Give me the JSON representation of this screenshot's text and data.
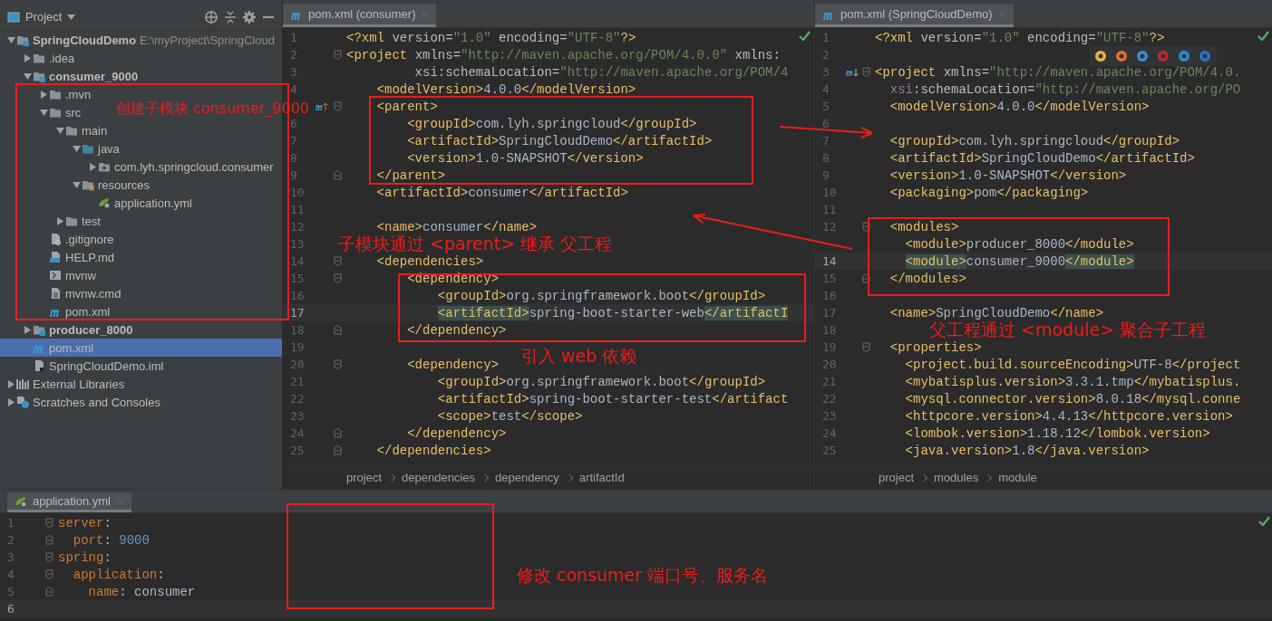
{
  "project_panel": {
    "title": "Project",
    "tree": [
      {
        "label": "SpringCloudDemo",
        "kind": "module",
        "hint": "E:\\myProject\\SpringCloud",
        "expanded": true,
        "selected": false,
        "children": [
          {
            "label": ".idea",
            "kind": "folder",
            "expanded": false,
            "selected": false
          },
          {
            "label": "consumer_9000",
            "kind": "module",
            "expanded": true,
            "selected": false,
            "children": [
              {
                "label": ".mvn",
                "kind": "folder",
                "expanded": false,
                "selected": false
              },
              {
                "label": "src",
                "kind": "folder",
                "expanded": true,
                "selected": false,
                "children": [
                  {
                    "label": "main",
                    "kind": "folder",
                    "expanded": true,
                    "selected": false,
                    "children": [
                      {
                        "label": "java",
                        "kind": "source",
                        "expanded": true,
                        "selected": false,
                        "children": [
                          {
                            "label": "com.lyh.springcloud.consumer",
                            "kind": "package",
                            "expanded": false,
                            "selected": false
                          }
                        ]
                      },
                      {
                        "label": "resources",
                        "kind": "resources",
                        "expanded": true,
                        "selected": false,
                        "children": [
                          {
                            "label": "application.yml",
                            "kind": "yml",
                            "selected": false
                          }
                        ]
                      }
                    ]
                  },
                  {
                    "label": "test",
                    "kind": "folder",
                    "expanded": false,
                    "selected": false
                  }
                ]
              },
              {
                "label": ".gitignore",
                "kind": "ignore",
                "selected": false
              },
              {
                "label": "HELP.md",
                "kind": "md",
                "selected": false
              },
              {
                "label": "mvnw",
                "kind": "script",
                "selected": false
              },
              {
                "label": "mvnw.cmd",
                "kind": "file",
                "selected": false
              },
              {
                "label": "pom.xml",
                "kind": "maven",
                "selected": false
              }
            ]
          },
          {
            "label": "producer_8000",
            "kind": "module",
            "expanded": false,
            "selected": false
          },
          {
            "label": "pom.xml",
            "kind": "maven",
            "selected": true
          },
          {
            "label": "SpringCloudDemo.iml",
            "kind": "iml",
            "selected": false
          }
        ]
      },
      {
        "label": "External Libraries",
        "kind": "libraries",
        "expanded": false,
        "selected": false
      },
      {
        "label": "Scratches and Consoles",
        "kind": "scratches",
        "expanded": false,
        "selected": false
      }
    ]
  },
  "editors": [
    {
      "tab": "pom.xml (consumer)",
      "breadcrumbs": [
        "project",
        "dependencies",
        "dependency",
        "artifactId"
      ],
      "lines": [
        {
          "n": "1",
          "kind": "plain",
          "current": false,
          "segs": [
            {
              "kind": "tag",
              "text": "<?xml "
            },
            {
              "kind": "attr",
              "text": "version="
            },
            {
              "kind": "value",
              "text": "\"1.0\""
            },
            {
              "kind": "attr",
              "text": " encoding="
            },
            {
              "kind": "value",
              "text": "\"UTF-8\""
            },
            {
              "kind": "tag",
              "text": "?>"
            }
          ]
        },
        {
          "n": "2",
          "kind": "fold-start",
          "current": false,
          "segs": [
            {
              "kind": "tag",
              "text": "<project "
            },
            {
              "kind": "attr",
              "text": "xmlns="
            },
            {
              "kind": "value",
              "text": "\"http://maven.apache.org/POM/4.0.0\""
            },
            {
              "kind": "attr",
              "text": " xmlns:"
            }
          ]
        },
        {
          "n": "3",
          "kind": "plain",
          "current": false,
          "segs": [
            {
              "kind": "attr",
              "text": "         xsi:schemaLocation="
            },
            {
              "kind": "value",
              "text": "\"http://maven.apache.org/POM/4"
            }
          ]
        },
        {
          "n": "4",
          "kind": "plain",
          "current": false,
          "segs": [
            {
              "kind": "tag",
              "text": "    <modelVersion>"
            },
            {
              "kind": "text",
              "text": "4.0.0"
            },
            {
              "kind": "tag",
              "text": "</modelVersion>"
            }
          ]
        },
        {
          "kind": "override-fold-start",
          "segs": [
            {
              "kind": "tag",
              "text": "    <parent>"
            }
          ]
        },
        {
          "n": "6",
          "kind": "plain",
          "current": false,
          "segs": [
            {
              "kind": "tag",
              "text": "        <groupId>"
            },
            {
              "kind": "text",
              "text": "com.lyh.springcloud"
            },
            {
              "kind": "tag",
              "text": "</groupId>"
            }
          ]
        },
        {
          "n": "7",
          "kind": "plain",
          "current": false,
          "segs": [
            {
              "kind": "tag",
              "text": "        <artifactId>"
            },
            {
              "kind": "text",
              "text": "SpringCloudDemo"
            },
            {
              "kind": "tag",
              "text": "</artifactId>"
            }
          ]
        },
        {
          "n": "8",
          "kind": "plain",
          "current": false,
          "segs": [
            {
              "kind": "tag",
              "text": "        <version>"
            },
            {
              "kind": "text",
              "text": "1.0-SNAPSHOT"
            },
            {
              "kind": "tag",
              "text": "</version>"
            }
          ]
        },
        {
          "n": "9",
          "kind": "fold-end",
          "current": false,
          "segs": [
            {
              "kind": "tag",
              "text": "    </parent>"
            }
          ]
        },
        {
          "n": "10",
          "kind": "plain",
          "current": false,
          "segs": [
            {
              "kind": "tag",
              "text": "    <artifactId>"
            },
            {
              "kind": "text",
              "text": "consumer"
            },
            {
              "kind": "tag",
              "text": "</artifactId>"
            }
          ]
        },
        {
          "n": "11",
          "kind": "plain",
          "current": false
        },
        {
          "n": "12",
          "kind": "plain",
          "current": false,
          "segs": [
            {
              "kind": "tag",
              "text": "    <name>"
            },
            {
              "kind": "text",
              "text": "consumer"
            },
            {
              "kind": "tag",
              "text": "</name>"
            }
          ]
        },
        {
          "n": "13",
          "kind": "plain",
          "current": false
        },
        {
          "n": "14",
          "kind": "fold-start",
          "current": false,
          "segs": [
            {
              "kind": "tag",
              "text": "    <dependencies>"
            }
          ]
        },
        {
          "n": "15",
          "kind": "fold-start",
          "current": false,
          "segs": [
            {
              "kind": "tag",
              "text": "        <dependency>"
            }
          ]
        },
        {
          "n": "16",
          "kind": "plain",
          "current": false,
          "segs": [
            {
              "kind": "tag",
              "text": "            <groupId>"
            },
            {
              "kind": "text",
              "text": "org.springframework.boot"
            },
            {
              "kind": "tag",
              "text": "</groupId>"
            }
          ]
        },
        {
          "n": "17",
          "kind": "plain",
          "current": true,
          "segs": [
            {
              "kind": "tag-match",
              "text": "            <artifactId>"
            },
            {
              "kind": "text",
              "text": "spring-boot-starter-web"
            },
            {
              "kind": "tag-match",
              "text": "</artifactI"
            }
          ]
        },
        {
          "n": "18",
          "kind": "fold-end",
          "current": false,
          "segs": [
            {
              "kind": "tag",
              "text": "        </dependency>"
            }
          ]
        },
        {
          "n": "19",
          "kind": "plain",
          "current": false
        },
        {
          "n": "20",
          "kind": "fold-start",
          "current": false,
          "segs": [
            {
              "kind": "tag",
              "text": "        <dependency>"
            }
          ]
        },
        {
          "n": "21",
          "kind": "plain",
          "current": false,
          "segs": [
            {
              "kind": "tag",
              "text": "            <groupId>"
            },
            {
              "kind": "text",
              "text": "org.springframework.boot"
            },
            {
              "kind": "tag",
              "text": "</groupId>"
            }
          ]
        },
        {
          "n": "22",
          "kind": "plain",
          "current": false,
          "segs": [
            {
              "kind": "tag",
              "text": "            <artifactId>"
            },
            {
              "kind": "text",
              "text": "spring-boot-starter-test"
            },
            {
              "kind": "tag",
              "text": "</artifact"
            }
          ]
        },
        {
          "n": "23",
          "kind": "plain",
          "current": false,
          "segs": [
            {
              "kind": "tag",
              "text": "            <scope>"
            },
            {
              "kind": "text",
              "text": "test"
            },
            {
              "kind": "tag",
              "text": "</scope>"
            }
          ]
        },
        {
          "n": "24",
          "kind": "fold-end",
          "current": false,
          "segs": [
            {
              "kind": "tag",
              "text": "        </dependency>"
            }
          ]
        },
        {
          "n": "25",
          "kind": "fold-end",
          "current": false,
          "segs": [
            {
              "kind": "tag",
              "text": "    </dependencies>"
            }
          ]
        }
      ]
    },
    {
      "tab": "pom.xml (SpringCloudDemo)",
      "breadcrumbs": [
        "project",
        "modules",
        "module"
      ],
      "lines": [
        {
          "n": "1",
          "kind": "plain",
          "current": false,
          "segs": [
            {
              "kind": "tag",
              "text": "<?xml "
            },
            {
              "kind": "attr",
              "text": "version="
            },
            {
              "kind": "value",
              "text": "\"1.0\""
            },
            {
              "kind": "attr",
              "text": " encoding="
            },
            {
              "kind": "value",
              "text": "\"UTF-8\""
            },
            {
              "kind": "tag",
              "text": "?>"
            }
          ]
        },
        {
          "n": "2",
          "kind": "browser-bar",
          "current": false
        },
        {
          "n": "3",
          "kind": "overridden-fold-start",
          "current": false,
          "segs": [
            {
              "kind": "tag",
              "text": "<project "
            },
            {
              "kind": "attr",
              "text": "xmlns="
            },
            {
              "kind": "value",
              "text": "\"http://maven.apache.org/POM/4.0."
            }
          ]
        },
        {
          "n": "4",
          "kind": "plain",
          "current": false,
          "segs": [
            {
              "kind": "ns",
              "text": "  xsi"
            },
            {
              "kind": "attr",
              "text": ":schemaLocation="
            },
            {
              "kind": "value",
              "text": "\"http://maven.apache.org/PO"
            }
          ]
        },
        {
          "n": "5",
          "kind": "plain",
          "current": false,
          "segs": [
            {
              "kind": "tag",
              "text": "  <modelVersion>"
            },
            {
              "kind": "text",
              "text": "4.0.0"
            },
            {
              "kind": "tag",
              "text": "</modelVersion>"
            }
          ]
        },
        {
          "n": "6",
          "kind": "plain",
          "current": false
        },
        {
          "n": "7",
          "kind": "plain",
          "current": false,
          "segs": [
            {
              "kind": "tag",
              "text": "  <groupId>"
            },
            {
              "kind": "text",
              "text": "com.lyh.springcloud"
            },
            {
              "kind": "tag",
              "text": "</groupId>"
            }
          ]
        },
        {
          "n": "8",
          "kind": "plain",
          "current": false,
          "segs": [
            {
              "kind": "tag",
              "text": "  <artifactId>"
            },
            {
              "kind": "text",
              "text": "SpringCloudDemo"
            },
            {
              "kind": "tag",
              "text": "</artifactId>"
            }
          ]
        },
        {
          "n": "9",
          "kind": "plain",
          "current": false,
          "segs": [
            {
              "kind": "tag",
              "text": "  <version>"
            },
            {
              "kind": "text",
              "text": "1.0-SNAPSHOT"
            },
            {
              "kind": "tag",
              "text": "</version>"
            }
          ]
        },
        {
          "n": "10",
          "kind": "plain",
          "current": false,
          "segs": [
            {
              "kind": "tag",
              "text": "  <packaging>"
            },
            {
              "kind": "text",
              "text": "pom"
            },
            {
              "kind": "tag",
              "text": "</packaging>"
            }
          ]
        },
        {
          "n": "11",
          "kind": "plain",
          "current": false
        },
        {
          "n": "12",
          "kind": "fold-start",
          "current": false,
          "segs": [
            {
              "kind": "tag",
              "text": "  <modules>"
            }
          ]
        },
        {
          "kind": "plain",
          "segs": [
            {
              "kind": "tag",
              "text": "    <module>"
            },
            {
              "kind": "text",
              "text": "producer_8000"
            },
            {
              "kind": "tag",
              "text": "</module>"
            }
          ]
        },
        {
          "n": "14",
          "kind": "plain",
          "current": true,
          "segs": [
            {
              "kind": "tag-match",
              "text": "    <module>"
            },
            {
              "kind": "text",
              "text": "consumer_9000"
            },
            {
              "kind": "tag-match",
              "text": "</module>"
            }
          ]
        },
        {
          "n": "15",
          "kind": "fold-end",
          "current": false,
          "segs": [
            {
              "kind": "tag",
              "text": "  </modules>"
            }
          ]
        },
        {
          "n": "16",
          "kind": "plain",
          "current": false
        },
        {
          "n": "17",
          "kind": "plain",
          "current": false,
          "segs": [
            {
              "kind": "tag",
              "text": "  <name>"
            },
            {
              "kind": "text",
              "text": "SpringCloudDemo"
            },
            {
              "kind": "tag",
              "text": "</name>"
            }
          ]
        },
        {
          "n": "18",
          "kind": "plain",
          "current": false
        },
        {
          "n": "19",
          "kind": "fold-start",
          "current": false,
          "segs": [
            {
              "kind": "tag",
              "text": "  <properties>"
            }
          ]
        },
        {
          "n": "20",
          "kind": "plain",
          "current": false,
          "segs": [
            {
              "kind": "tag",
              "text": "    <project.build.sourceEncoding>"
            },
            {
              "kind": "text",
              "text": "UTF-8"
            },
            {
              "kind": "tag",
              "text": "</project"
            }
          ]
        },
        {
          "n": "21",
          "kind": "plain",
          "current": false,
          "segs": [
            {
              "kind": "tag",
              "text": "    <mybatisplus.version>"
            },
            {
              "kind": "text",
              "text": "3.3.1.tmp"
            },
            {
              "kind": "tag",
              "text": "</mybatisplus."
            }
          ]
        },
        {
          "n": "22",
          "kind": "plain",
          "current": false,
          "segs": [
            {
              "kind": "tag",
              "text": "    <mysql.connector.version>"
            },
            {
              "kind": "text",
              "text": "8.0.18"
            },
            {
              "kind": "tag",
              "text": "</mysql.conne"
            }
          ]
        },
        {
          "n": "23",
          "kind": "plain",
          "current": false,
          "segs": [
            {
              "kind": "tag",
              "text": "    <httpcore.version>"
            },
            {
              "kind": "text",
              "text": "4.4.13"
            },
            {
              "kind": "tag",
              "text": "</httpcore.version>"
            }
          ]
        },
        {
          "n": "24",
          "kind": "plain",
          "current": false,
          "segs": [
            {
              "kind": "tag",
              "text": "    <lombok.version>"
            },
            {
              "kind": "text",
              "text": "1.18.12"
            },
            {
              "kind": "tag",
              "text": "</lombok.version>"
            }
          ]
        },
        {
          "n": "25",
          "kind": "plain",
          "current": false,
          "segs": [
            {
              "kind": "tag",
              "text": "    <java.version>"
            },
            {
              "kind": "text",
              "text": "1.8"
            },
            {
              "kind": "tag",
              "text": "</java.version>"
            }
          ]
        }
      ]
    }
  ],
  "bottom_editor": {
    "tab": "application.yml",
    "lines": [
      {
        "n": "1",
        "kind": "fold-start",
        "current": false,
        "segs": [
          {
            "kind": "key",
            "text": "server"
          },
          {
            "kind": "text",
            "text": ":"
          }
        ]
      },
      {
        "n": "2",
        "kind": "fold-end",
        "current": false,
        "segs": [
          {
            "kind": "key",
            "text": "  port"
          },
          {
            "kind": "text",
            "text": ": "
          },
          {
            "kind": "num",
            "text": "9000"
          }
        ]
      },
      {
        "n": "3",
        "kind": "fold-start",
        "current": false,
        "segs": [
          {
            "kind": "key",
            "text": "spring"
          },
          {
            "kind": "text",
            "text": ":"
          }
        ]
      },
      {
        "n": "4",
        "kind": "fold-start",
        "current": false,
        "segs": [
          {
            "kind": "key",
            "text": "  application"
          },
          {
            "kind": "text",
            "text": ":"
          }
        ]
      },
      {
        "n": "5",
        "kind": "fold-end",
        "current": false,
        "segs": [
          {
            "kind": "key",
            "text": "    name"
          },
          {
            "kind": "text",
            "text": ": consumer"
          }
        ]
      },
      {
        "n": "6",
        "kind": "plain",
        "current": true
      }
    ]
  },
  "annotations": [
    "创建子模块 consumer_9000",
    "子模块通过 <parent> 继承 父工程",
    "引入 web 依赖",
    "父工程通过 <module> 聚合子工程",
    "修改 consumer 端口号、服务名"
  ]
}
